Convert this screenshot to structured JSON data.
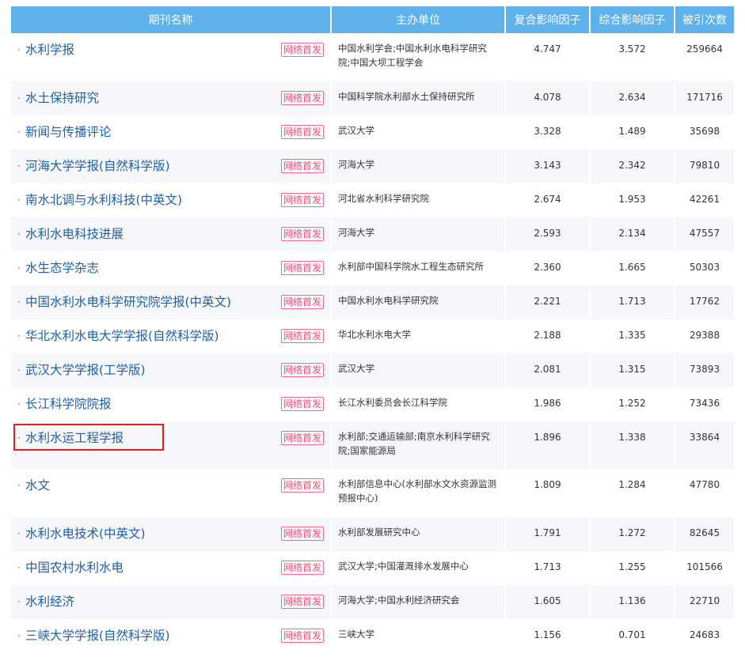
{
  "headers": {
    "name": "期刊名称",
    "org": "主办单位",
    "fuhe": "复合影响因子",
    "zonghe": "综合影响因子",
    "cited": "被引次数"
  },
  "badge_label": "网络首发",
  "rows": [
    {
      "name": "水利学报",
      "org": "中国水利学会;中国水利水电科学研究院;中国大坝工程学会",
      "fuhe": "4.747",
      "zonghe": "3.572",
      "cited": "259664"
    },
    {
      "name": "水土保持研究",
      "org": "中国科学院水利部水土保持研究所",
      "fuhe": "4.078",
      "zonghe": "2.634",
      "cited": "171716"
    },
    {
      "name": "新闻与传播评论",
      "org": "武汉大学",
      "fuhe": "3.328",
      "zonghe": "1.489",
      "cited": "35698"
    },
    {
      "name": "河海大学学报(自然科学版)",
      "org": "河海大学",
      "fuhe": "3.143",
      "zonghe": "2.342",
      "cited": "79810"
    },
    {
      "name": "南水北调与水利科技(中英文)",
      "org": "河北省水利科学研究院",
      "fuhe": "2.674",
      "zonghe": "1.953",
      "cited": "42261"
    },
    {
      "name": "水利水电科技进展",
      "org": "河海大学",
      "fuhe": "2.593",
      "zonghe": "2.134",
      "cited": "47557"
    },
    {
      "name": "水生态学杂志",
      "org": "水利部中国科学院水工程生态研究所",
      "fuhe": "2.360",
      "zonghe": "1.665",
      "cited": "50303"
    },
    {
      "name": "中国水利水电科学研究院学报(中英文)",
      "org": "中国水利水电科学研究院",
      "fuhe": "2.221",
      "zonghe": "1.713",
      "cited": "17762"
    },
    {
      "name": "华北水利水电大学学报(自然科学版)",
      "org": "华北水利水电大学",
      "fuhe": "2.188",
      "zonghe": "1.335",
      "cited": "29388"
    },
    {
      "name": "武汉大学学报(工学版)",
      "org": "武汉大学",
      "fuhe": "2.081",
      "zonghe": "1.315",
      "cited": "73893"
    },
    {
      "name": "长江科学院院报",
      "org": "长江水利委员会长江科学院",
      "fuhe": "1.986",
      "zonghe": "1.252",
      "cited": "73436"
    },
    {
      "name": "水利水运工程学报",
      "org": "水利部;交通运输部;南京水利科学研究院;国家能源局",
      "fuhe": "1.896",
      "zonghe": "1.338",
      "cited": "33864"
    },
    {
      "name": "水文",
      "org": "水利部信息中心(水利部水文水资源监测预报中心)",
      "fuhe": "1.809",
      "zonghe": "1.284",
      "cited": "47780"
    },
    {
      "name": "水利水电技术(中英文)",
      "org": "水利部发展研究中心",
      "fuhe": "1.791",
      "zonghe": "1.272",
      "cited": "82645"
    },
    {
      "name": "中国农村水利水电",
      "org": "武汉大学;中国灌溉排水发展中心",
      "fuhe": "1.713",
      "zonghe": "1.255",
      "cited": "101566"
    },
    {
      "name": "水利经济",
      "org": "河海大学;中国水利经济研究会",
      "fuhe": "1.605",
      "zonghe": "1.136",
      "cited": "22710"
    },
    {
      "name": "三峡大学学报(自然科学版)",
      "org": "三峡大学",
      "fuhe": "1.156",
      "zonghe": "0.701",
      "cited": "24683"
    }
  ],
  "highlighted_row_index": 11,
  "colors": {
    "header_bg": "#5fb1ec",
    "link": "#1f5fa8",
    "badge": "#f05076",
    "highlight_box": "#e21e1e"
  }
}
